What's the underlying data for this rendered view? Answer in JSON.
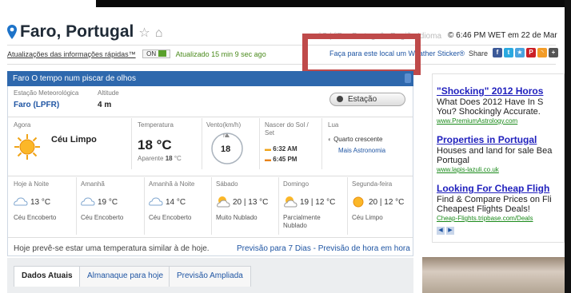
{
  "header": {
    "title": "Faro, Portugal",
    "faded_items": [
      "°C | °F",
      "Português",
      "Região",
      "Idioma"
    ],
    "datetime": "© 6:46 PM WET em 22 de Mar"
  },
  "updates_bar": {
    "label": "Atualizações das informações rápidas™",
    "toggle_label": "ON",
    "updated_text": "Atualizado 15 min 9 sec ago",
    "sticker_link": "Faça para este local um Weather Sticker®",
    "share_label": "Share"
  },
  "panel": {
    "header": "Faro O tempo num piscar de olhos",
    "station_label": "Estação Meteorológica",
    "station_value": "Faro (LPFR)",
    "altitude_label": "Altitude",
    "altitude_value": "4 m",
    "station_button": "Estação",
    "now_label": "Agora",
    "condition": "Céu Limpo",
    "temp_label": "Temperatura",
    "temperature": "18 °C",
    "apparent_label": "Aparente",
    "apparent_value": "18",
    "apparent_unit": "°C",
    "wind_label": "Vento(km/h)",
    "wind_dir": "N",
    "wind_value": "18",
    "sun_label": "Nascer do Sol / Set",
    "sunrise": "6:32 AM",
    "sunset": "6:45 PM",
    "moon_label": "Lua",
    "moon_phase": "Quarto crescente",
    "moon_link": "Mais Astronomia",
    "forecast": [
      {
        "day": "Hoje à Noite",
        "temp": "13 °C",
        "cond": "Céu Encoberto"
      },
      {
        "day": "Amanhã",
        "temp": "19 °C",
        "cond": "Céu Encoberto"
      },
      {
        "day": "Amanhã à Noite",
        "temp": "14 °C",
        "cond": "Céu Encoberto"
      },
      {
        "day": "Sábado",
        "temp": "20 | 13 °C",
        "cond": "Muito Nublado"
      },
      {
        "day": "Domingo",
        "temp": "19 | 12 °C",
        "cond": "Parcialmente Nublado"
      },
      {
        "day": "Segunda-feira",
        "temp": "20 | 12 °C",
        "cond": "Céu Limpo"
      }
    ],
    "summary": "Hoje prevê-se estar uma temperatura similar à de hoje.",
    "links": "Previsão para 7 Dias - Previsão de hora em hora"
  },
  "tabs": [
    "Dados Atuais",
    "Almanaque para hoje",
    "Previsão Ampliada"
  ],
  "ads": [
    {
      "title": "\"Shocking\" 2012 Horos",
      "body": [
        "What Does 2012 Have In S",
        "You? Shockingly Accurate."
      ],
      "url": "www.PremiumAstrology.com"
    },
    {
      "title": "Properties in Portugal",
      "body": [
        "Houses and land for sale Bea",
        "Portugal"
      ],
      "url": "www.lapis-lazuli.co.uk"
    },
    {
      "title": "Looking For Cheap Fligh",
      "body": [
        "Find & Compare Prices on Fli",
        "Cheapest Flights Deals!"
      ],
      "url": "Cheap-Flights.tripbase.com/Deals"
    }
  ],
  "colors": {
    "accent": "#2e68ad",
    "link": "#1f55a3",
    "highlight_box": "#bf4a4a",
    "ad_title": "#1f1fbd"
  }
}
